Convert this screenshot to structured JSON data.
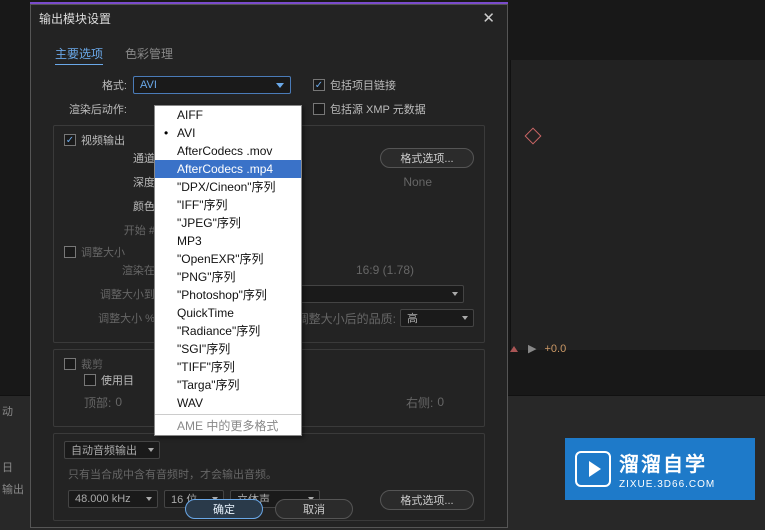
{
  "dialog": {
    "title": "输出模块设置",
    "tabs": {
      "main": "主要选项",
      "color": "色彩管理"
    },
    "labels": {
      "format": "格式:",
      "postRender": "渲染后动作:",
      "channel": "通道:",
      "depth": "深度:",
      "color": "颜色:",
      "start": "开始 #:",
      "resizeTo": "调整大小到:",
      "resizePercent": "调整大小 %:",
      "renderIn": "渲染在:",
      "useRow": "使用目",
      "top": "顶部:",
      "right": "右侧:"
    },
    "values": {
      "format": "AVI",
      "none": "None",
      "order": "调整大小后的品质:",
      "quality": "高",
      "aspect": "16:9 (1.78)",
      "topVal": "0",
      "rightVal": "0"
    },
    "checks": {
      "includeLink": "包括项目链接",
      "includeXmp": "包括源 XMP 元数据",
      "videoOut": "视频输出",
      "resize": "调整大小",
      "crop": "裁剪"
    },
    "buttons": {
      "formatOpts": "格式选项...",
      "formatOpts2": "格式选项...",
      "ok": "确定",
      "cancel": "取消"
    },
    "audio": {
      "mode": "自动音频输出",
      "note": "只有当合成中含有音频时，才会输出音频。",
      "khz": "48.000 kHz",
      "bit": "16 位",
      "ch": "立体声"
    }
  },
  "dropdown": {
    "items": [
      "AIFF",
      "AVI",
      "AfterCodecs .mov",
      "AfterCodecs .mp4",
      "\"DPX/Cineon\"序列",
      "\"IFF\"序列",
      "\"JPEG\"序列",
      "MP3",
      "\"OpenEXR\"序列",
      "\"PNG\"序列",
      "\"Photoshop\"序列",
      "QuickTime",
      "\"Radiance\"序列",
      "\"SGI\"序列",
      "\"TIFF\"序列",
      "\"Targa\"序列",
      "WAV"
    ],
    "more": "AME 中的更多格式"
  },
  "bg": {
    "left1": "动",
    "left2": "日",
    "left3": "输出",
    "plus": "+0.0"
  },
  "logo": {
    "title": "溜溜自学",
    "url": "ZIXUE.3D66.COM"
  }
}
